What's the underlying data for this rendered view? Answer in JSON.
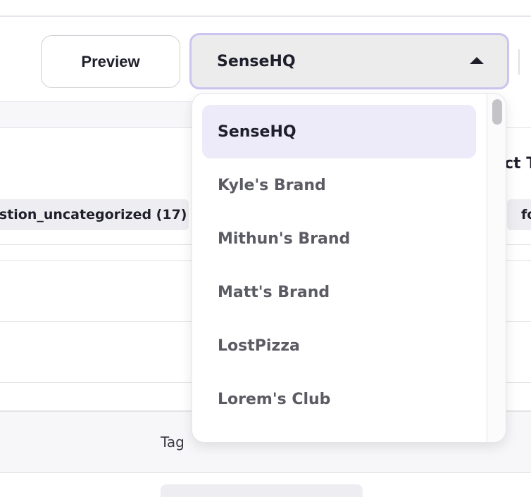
{
  "toolbar": {
    "preview_label": "Preview",
    "brand_select_value": "SenseHQ"
  },
  "background": {
    "chip_text": "estion_uncategorized (17)",
    "chip_right_text": "fo",
    "column_header_partial": "ct T",
    "tag_label": "Tag"
  },
  "brand_dropdown": {
    "options": [
      {
        "label": "SenseHQ",
        "selected": true
      },
      {
        "label": "Kyle's Brand",
        "selected": false
      },
      {
        "label": "Mithun's Brand",
        "selected": false
      },
      {
        "label": "Matt's Brand",
        "selected": false
      },
      {
        "label": "LostPizza",
        "selected": false
      },
      {
        "label": "Lorem's Club",
        "selected": false
      }
    ]
  },
  "icons": {
    "select_caret": "caret-up-icon"
  },
  "colors": {
    "accent_border": "#cbc4ef",
    "selected_option_bg": "#edeaf9"
  }
}
